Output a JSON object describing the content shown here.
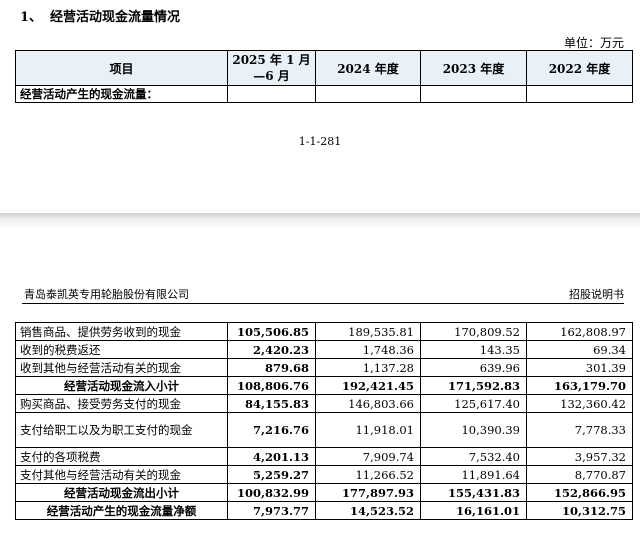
{
  "section": {
    "number": "1、",
    "title": "经营活动现金流量情况"
  },
  "unit": "单位：万元",
  "top_table": {
    "headers": [
      "项目",
      "2025 年 1 月—6 月",
      "2024 年度",
      "2023 年度",
      "2022 年度"
    ],
    "row_label": "经营活动产生的现金流量："
  },
  "page_number": "1-1-281",
  "running_header": {
    "company": "青岛泰凯英专用轮胎股份有限公司",
    "doc": "招股说明书"
  },
  "rows": [
    {
      "label": "销售商品、提供劳务收到的现金",
      "values": [
        "105,506.85",
        "189,535.81",
        "170,809.52",
        "162,808.97"
      ]
    },
    {
      "label": "收到的税费返还",
      "values": [
        "2,420.23",
        "1,748.36",
        "143.35",
        "69.34"
      ]
    },
    {
      "label": "收到其他与经营活动有关的现金",
      "values": [
        "879.68",
        "1,137.28",
        "639.96",
        "301.39"
      ]
    },
    {
      "label": "经营活动现金流入小计",
      "values": [
        "108,806.76",
        "192,421.45",
        "171,592.83",
        "163,179.70"
      ]
    },
    {
      "label": "购买商品、接受劳务支付的现金",
      "values": [
        "84,155.83",
        "146,803.66",
        "125,617.40",
        "132,360.42"
      ]
    },
    {
      "label": "支付给职工以及为职工支付的现金",
      "values": [
        "7,216.76",
        "11,918.01",
        "10,390.39",
        "7,778.33"
      ]
    },
    {
      "label": "支付的各项税费",
      "values": [
        "4,201.13",
        "7,909.74",
        "7,532.40",
        "3,957.32"
      ]
    },
    {
      "label": "支付其他与经营活动有关的现金",
      "values": [
        "5,259.27",
        "11,266.52",
        "11,891.64",
        "8,770.87"
      ]
    },
    {
      "label": "经营活动现金流出小计",
      "values": [
        "100,832.99",
        "177,897.93",
        "155,431.83",
        "152,866.95"
      ]
    },
    {
      "label": "经营活动产生的现金流量净额",
      "values": [
        "7,973.77",
        "14,523.52",
        "16,161.01",
        "10,312.75"
      ]
    }
  ]
}
